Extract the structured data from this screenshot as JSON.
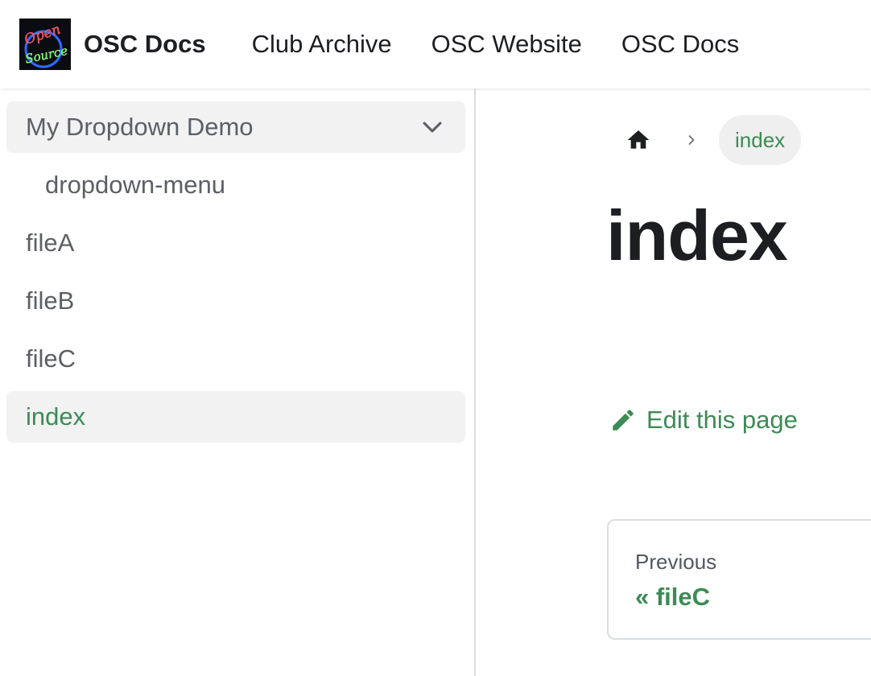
{
  "navbar": {
    "logo_text": [
      "Open",
      "Source"
    ],
    "title": "OSC Docs",
    "links": [
      {
        "label": "Club Archive"
      },
      {
        "label": "OSC Website"
      },
      {
        "label": "OSC Docs"
      }
    ]
  },
  "sidebar": {
    "category": {
      "label": "My Dropdown Demo",
      "icon": "chevron-down-icon"
    },
    "items": [
      {
        "label": "dropdown-menu"
      },
      {
        "label": "fileA"
      },
      {
        "label": "fileB"
      },
      {
        "label": "fileC"
      },
      {
        "label": "index"
      }
    ]
  },
  "breadcrumbs": {
    "home_icon": "home-icon",
    "current": "index"
  },
  "page": {
    "title": "index",
    "edit_label": "Edit this page",
    "edit_icon": "pencil-icon"
  },
  "pager": {
    "sub_label": "Previous",
    "label": "« fileC"
  },
  "colors": {
    "accent": "#3d8b55",
    "active_bg": "#f2f2f2",
    "text": "#1c1e21",
    "muted": "#5c5f66"
  }
}
